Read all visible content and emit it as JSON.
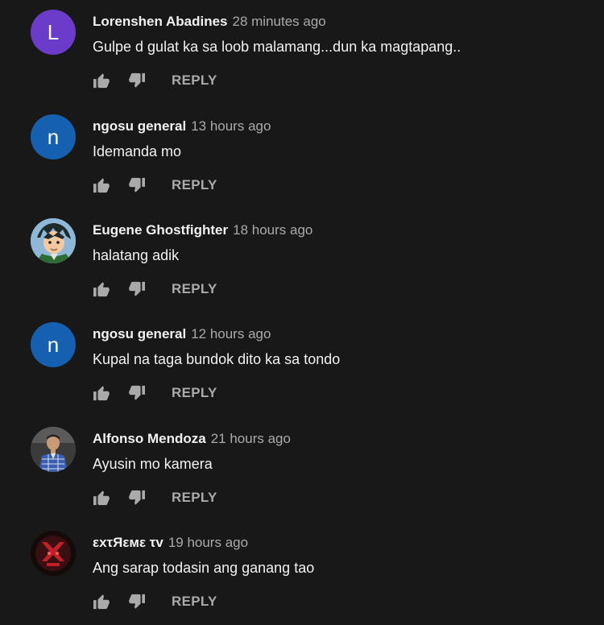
{
  "comments": [
    {
      "author": "Lorenshen Abadines",
      "time": "28 minutes ago",
      "text": "Gulpe d gulat ka sa loob malamang...dun ka magtapang..",
      "avatar_letter": "L",
      "avatar_color": "#6a3cc9",
      "reply_label": "REPLY"
    },
    {
      "author": "ngosu general",
      "time": "13 hours ago",
      "text": "Idemanda mo",
      "avatar_letter": "n",
      "avatar_color": "#1560b0",
      "reply_label": "REPLY"
    },
    {
      "author": "Eugene Ghostfighter",
      "time": "18 hours ago",
      "text": "halatang adik",
      "avatar_letter": "",
      "avatar_color": "#8fb7d8",
      "reply_label": "REPLY"
    },
    {
      "author": "ngosu general",
      "time": "12 hours ago",
      "text": "Kupal na taga bundok dito ka sa tondo",
      "avatar_letter": "n",
      "avatar_color": "#1560b0",
      "reply_label": "REPLY"
    },
    {
      "author": "Alfonso Mendoza",
      "time": "21 hours ago",
      "text": "Ayusin mo kamera",
      "avatar_letter": "",
      "avatar_color": "#3a3a3a",
      "reply_label": "REPLY"
    },
    {
      "author": "εxτЯεмε τv",
      "time": "19 hours ago",
      "text": "Ang sarap todasin ang ganang tao",
      "avatar_letter": "",
      "avatar_color": "#1a0d0d",
      "reply_label": "REPLY"
    }
  ],
  "colors": {
    "background": "#181818",
    "primary_text": "#f1f1f1",
    "secondary_text": "#aaaaaa"
  },
  "icons": {
    "like": "thumbs-up-icon",
    "dislike": "thumbs-down-icon"
  }
}
